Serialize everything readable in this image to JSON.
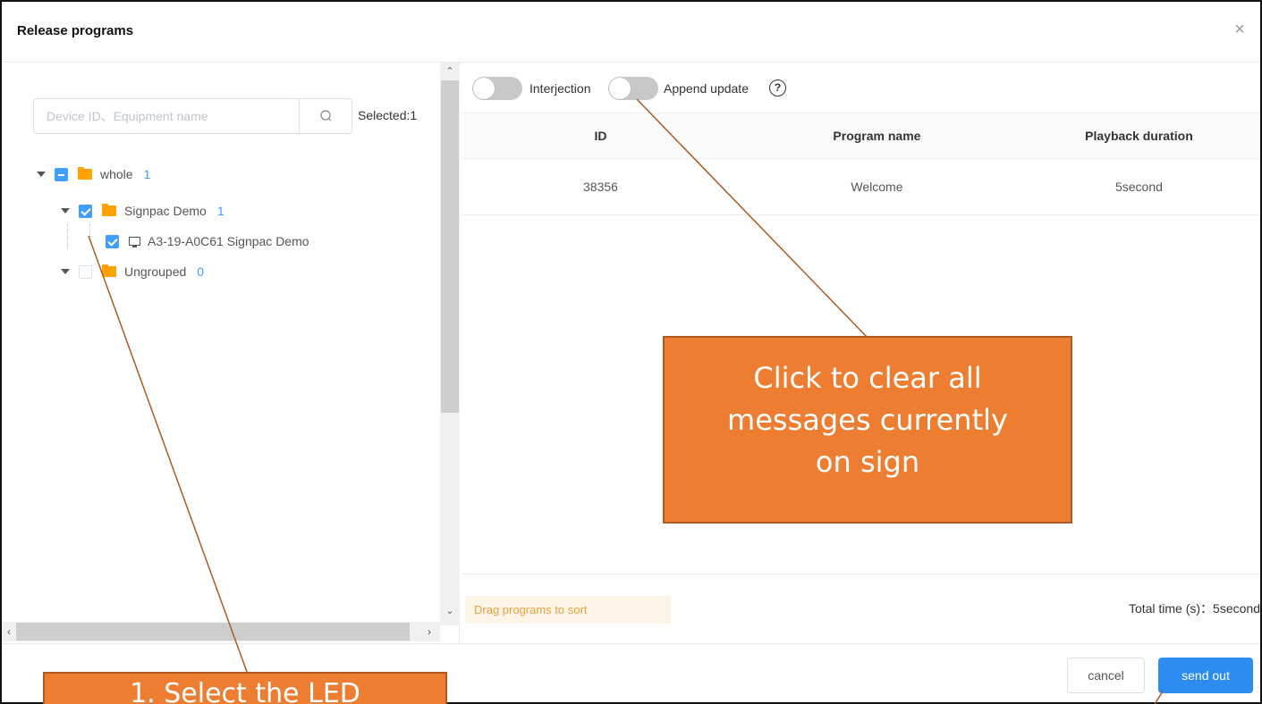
{
  "dialog": {
    "title": "Release programs",
    "close_icon": "×"
  },
  "left": {
    "search_placeholder": "Device ID、Equipment name",
    "selected_label": "Selected:1",
    "tree": [
      {
        "label": "whole",
        "count": "1",
        "checkbox": "indeterminate"
      },
      {
        "label": "Signpac Demo",
        "count": "1",
        "checkbox": "checked"
      },
      {
        "label": "A3-19-A0C61 Signpac Demo",
        "checkbox": "checked"
      },
      {
        "label": "Ungrouped",
        "count": "0",
        "checkbox": "unchecked"
      }
    ]
  },
  "right": {
    "toggle_interjection": "Interjection",
    "toggle_append": "Append update",
    "help_glyph": "?",
    "table": {
      "headers": [
        "ID",
        "Program name",
        "Playback duration"
      ],
      "rows": [
        [
          "38356",
          "Welcome",
          "5second"
        ]
      ]
    },
    "drag_hint": "Drag programs to sort",
    "total_time": "Total time (s)：5second"
  },
  "footer": {
    "cancel_label": "cancel",
    "send_label": "send out"
  },
  "annotations": {
    "callout_1_lines": [
      "Click to clear all",
      "messages currently",
      "on sign"
    ],
    "callout_2_text": "1.  Select the LED",
    "callout_color": "#ED7D31"
  },
  "colors": {
    "accent_blue": "#409EFF",
    "primary_button": "#2D8CF0",
    "folder": "#FFA200"
  }
}
